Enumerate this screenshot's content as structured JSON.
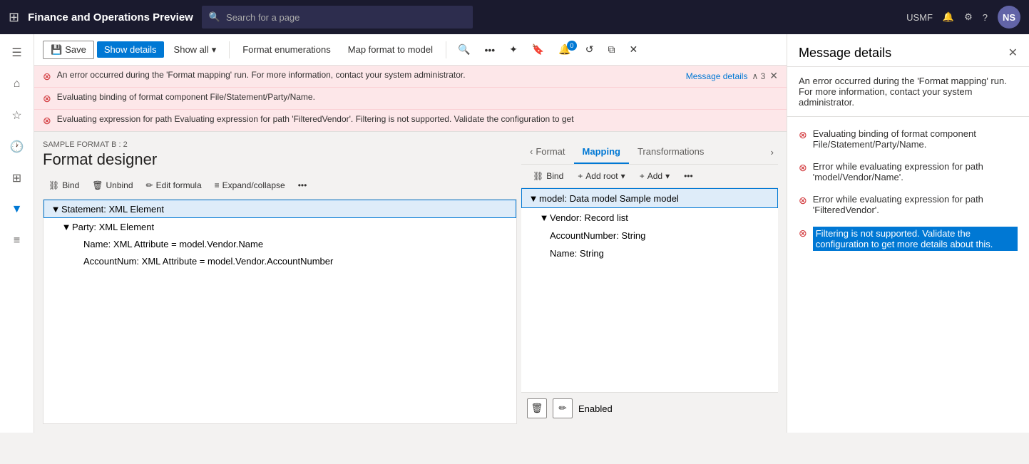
{
  "topbar": {
    "title": "Finance and Operations Preview",
    "search_placeholder": "Search for a page",
    "user_initials": "NS",
    "region": "USMF"
  },
  "toolbar": {
    "save_label": "Save",
    "show_details_label": "Show details",
    "show_all_label": "Show all",
    "format_enumerations_label": "Format enumerations",
    "map_format_label": "Map format to model"
  },
  "errors": [
    {
      "text": "An error occurred during the 'Format mapping' run. For more information, contact your system administrator.",
      "link_text": "Message details",
      "count": "3"
    },
    {
      "text": "Evaluating binding of format component File/Statement/Party/Name."
    },
    {
      "text": "Evaluating expression for path",
      "extra": "Evaluating expression for path 'FilteredVendor'. Filtering is not supported. Validate the configuration to get"
    }
  ],
  "designer": {
    "sample_label": "SAMPLE FORMAT B : 2",
    "title": "Format designer",
    "toolbar": {
      "bind": "Bind",
      "unbind": "Unbind",
      "edit_formula": "Edit formula",
      "expand_collapse": "Expand/collapse"
    }
  },
  "tree_left": {
    "items": [
      {
        "label": "Statement: XML Element",
        "level": 0,
        "selected": true
      },
      {
        "label": "Party: XML Element",
        "level": 1
      },
      {
        "label": "Name: XML Attribute = model.Vendor.Name",
        "level": 2
      },
      {
        "label": "AccountNum: XML Attribute = model.Vendor.AccountNumber",
        "level": 2
      }
    ]
  },
  "tabs": {
    "format_label": "Format",
    "mapping_label": "Mapping",
    "transformations_label": "Transformations"
  },
  "tree_right": {
    "toolbar": {
      "bind": "Bind",
      "add_root": "Add root",
      "add": "Add"
    },
    "items": [
      {
        "label": "model: Data model Sample model",
        "level": 0,
        "selected": true
      },
      {
        "label": "Vendor: Record list",
        "level": 1
      },
      {
        "label": "AccountNumber: String",
        "level": 2
      },
      {
        "label": "Name: String",
        "level": 2
      }
    ]
  },
  "bottom_right": {
    "status": "Enabled"
  },
  "message_details": {
    "title": "Message details",
    "description": "An error occurred during the 'Format mapping' run. For more information, contact your system administrator.",
    "errors": [
      {
        "text": "Evaluating binding of format component File/Statement/Party/Name."
      },
      {
        "text": "Error while evaluating expression for path 'model/Vendor/Name'."
      },
      {
        "text": "Error while evaluating expression for path 'FilteredVendor'."
      },
      {
        "text": "Filtering is not supported. Validate the configuration to get more details about this.",
        "highlighted": true
      }
    ]
  }
}
